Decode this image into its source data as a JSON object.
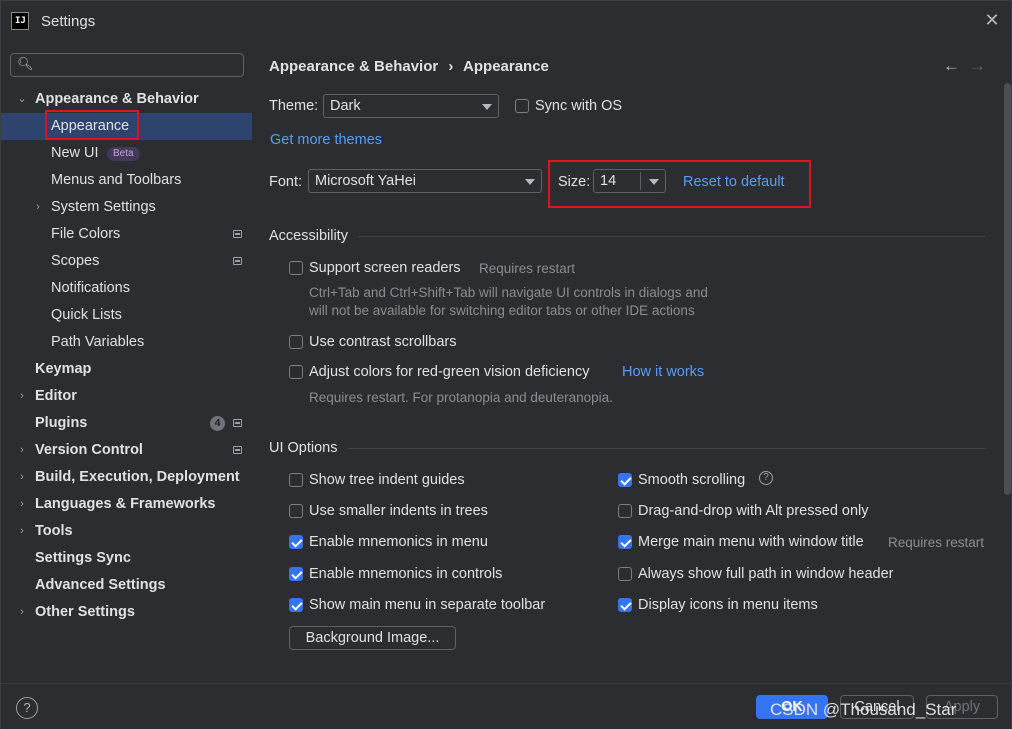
{
  "window": {
    "title": "Settings",
    "app_icon": "IJ"
  },
  "sidebar": {
    "search_placeholder": "",
    "items": [
      {
        "label": "Appearance & Behavior",
        "expandable": true,
        "expanded": true
      },
      {
        "label": "Appearance",
        "selected": true
      },
      {
        "label": "New UI",
        "badge": "Beta"
      },
      {
        "label": "Menus and Toolbars"
      },
      {
        "label": "System Settings",
        "expandable": true
      },
      {
        "label": "File Colors"
      },
      {
        "label": "Scopes"
      },
      {
        "label": "Notifications"
      },
      {
        "label": "Quick Lists"
      },
      {
        "label": "Path Variables"
      },
      {
        "label": "Keymap"
      },
      {
        "label": "Editor",
        "expandable": true
      },
      {
        "label": "Plugins",
        "count": "4"
      },
      {
        "label": "Version Control",
        "expandable": true
      },
      {
        "label": "Build, Execution, Deployment",
        "expandable": true
      },
      {
        "label": "Languages & Frameworks",
        "expandable": true
      },
      {
        "label": "Tools",
        "expandable": true
      },
      {
        "label": "Settings Sync"
      },
      {
        "label": "Advanced Settings"
      },
      {
        "label": "Other Settings",
        "expandable": true
      }
    ]
  },
  "breadcrumb": {
    "parent": "Appearance & Behavior",
    "separator": "›",
    "current": "Appearance"
  },
  "nav": {
    "back": "←",
    "forward": "→"
  },
  "theme": {
    "label": "Theme:",
    "value": "Dark",
    "sync_label": "Sync with OS",
    "sync_checked": false,
    "more_link": "Get more themes"
  },
  "font": {
    "label": "Font:",
    "value": "Microsoft YaHei",
    "size_label": "Size:",
    "size_value": "14",
    "reset_link": "Reset to default"
  },
  "accessibility": {
    "heading": "Accessibility",
    "screen_readers": {
      "label": "Support screen readers",
      "checked": false,
      "hint": "Requires restart",
      "desc1": "Ctrl+Tab and Ctrl+Shift+Tab will navigate UI controls in dialogs and",
      "desc2": "will not be available for switching editor tabs or other IDE actions"
    },
    "contrast_scrollbars": {
      "label": "Use contrast scrollbars",
      "checked": false
    },
    "color_deficiency": {
      "label": "Adjust colors for red-green vision deficiency",
      "checked": false,
      "link": "How it works",
      "desc": "Requires restart. For protanopia and deuteranopia."
    }
  },
  "ui_options": {
    "heading": "UI Options",
    "left": [
      {
        "label": "Show tree indent guides",
        "checked": false
      },
      {
        "label": "Use smaller indents in trees",
        "checked": false
      },
      {
        "label": "Enable mnemonics in menu",
        "checked": true
      },
      {
        "label": "Enable mnemonics in controls",
        "checked": true
      },
      {
        "label": "Show main menu in separate toolbar",
        "checked": true
      }
    ],
    "right": [
      {
        "label": "Smooth scrolling",
        "checked": true
      },
      {
        "label": "Drag-and-drop with Alt pressed only",
        "checked": false
      },
      {
        "label": "Merge main menu with window title",
        "checked": true,
        "hint": "Requires restart"
      },
      {
        "label": "Always show full path in window header",
        "checked": false
      },
      {
        "label": "Display icons in menu items",
        "checked": true
      }
    ],
    "background_button": "Background Image..."
  },
  "footer": {
    "help": "?",
    "ok": "OK",
    "cancel": "Cancel",
    "apply": "Apply",
    "watermark": "CSDN @Thousand_Star"
  },
  "colors": {
    "accent": "#3574f0",
    "link": "#589df6",
    "selection": "#2e436e",
    "highlight_box": "#e3131b"
  },
  "icons": [
    "search-icon",
    "close-icon",
    "chevron-down-icon",
    "chevron-right-icon",
    "settings-page-icon",
    "help-icon",
    "back-arrow-icon",
    "forward-arrow-icon"
  ]
}
